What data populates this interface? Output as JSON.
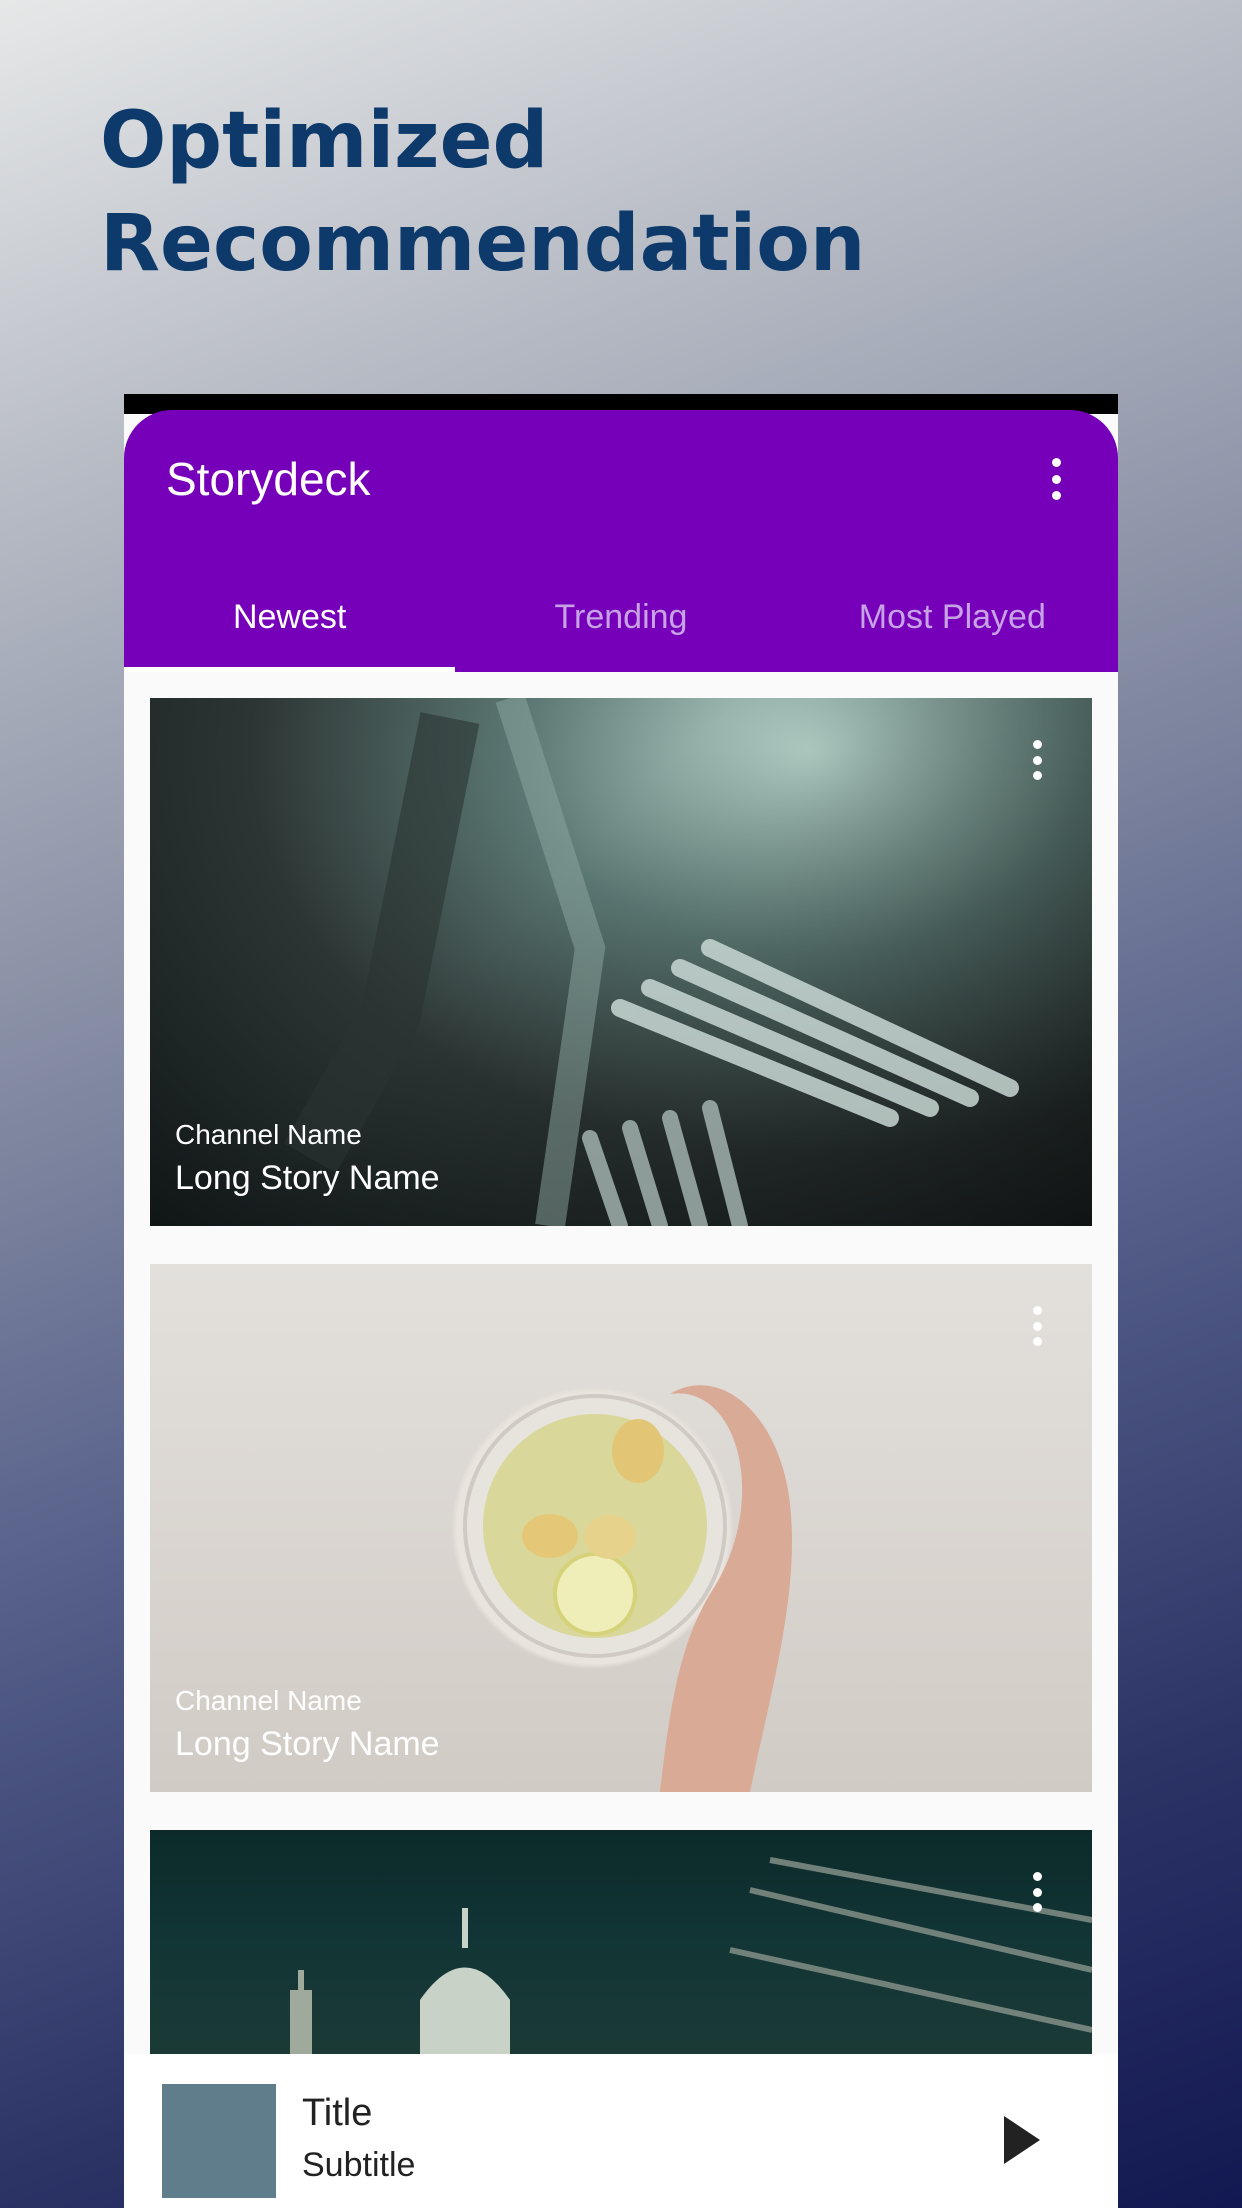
{
  "headline": {
    "line1": "Optimized",
    "line2": "Recommendation"
  },
  "app": {
    "title": "Storydeck",
    "menu_icon": "more-vert-icon",
    "accent_color": "#7600b9"
  },
  "tabs": [
    {
      "label": "Newest",
      "active": true
    },
    {
      "label": "Trending",
      "active": false
    },
    {
      "label": "Most Played",
      "active": false
    }
  ],
  "cards": [
    {
      "channel": "Channel Name",
      "story": "Long Story Name",
      "image": "forks photo"
    },
    {
      "channel": "Channel Name",
      "story": "Long Story Name",
      "image": "ginger lemon tea photo"
    },
    {
      "channel": "",
      "story": "",
      "image": "london skyline photo"
    }
  ],
  "player": {
    "title": "Title",
    "subtitle": "Subtitle",
    "play_icon": "play-icon",
    "thumb_color": "#607d8b"
  }
}
